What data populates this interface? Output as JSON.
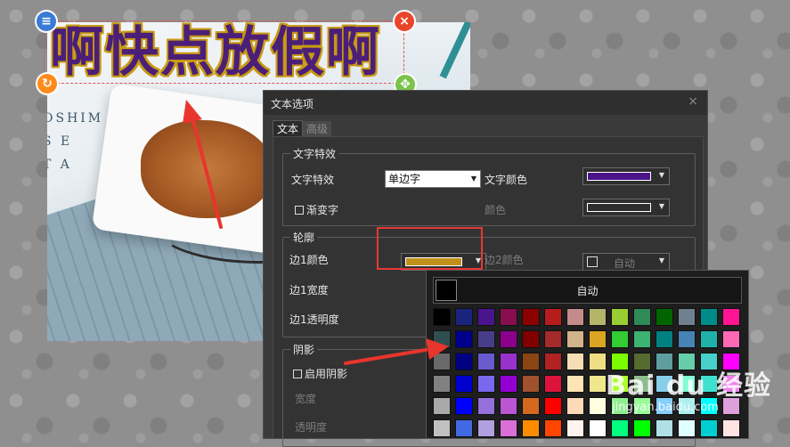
{
  "canvas": {
    "title_text": "啊快点放假啊",
    "photo_text": "OSHIM\nS E\nT A"
  },
  "dialog": {
    "title": "文本选项",
    "close_glyph": "×",
    "tabs": [
      {
        "label": "文本",
        "active": true
      },
      {
        "label": "高级",
        "active": false
      }
    ],
    "effects": {
      "legend": "文字特效",
      "effect_label": "文字特效",
      "effect_value": "单边字",
      "text_color_label": "文字颜色",
      "text_color": "#4b148a",
      "gradient_label": "渐变字",
      "color_label": "颜色",
      "color_value": "#2e2e2e"
    },
    "outline": {
      "legend": "轮廓",
      "edge1_color_label": "边1颜色",
      "edge1_color": "#c0901a",
      "edge2_color_label": "边2颜色",
      "edge2_auto": "自动",
      "edge1_width_label": "边1宽度",
      "edge1_opacity_label": "边1透明度"
    },
    "shadow": {
      "legend": "阴影",
      "enable_label": "启用阴影",
      "width_label": "宽度",
      "opacity_label": "透明度"
    }
  },
  "color_popup": {
    "auto_label": "自动",
    "colors": [
      [
        "#000000",
        "#1a237e",
        "#4a148c",
        "#880e4f",
        "#8b0000",
        "#b71c1c",
        "#c48b8b",
        "#b5b56a",
        "#9acd32",
        "#2e8b57",
        "#006400",
        "#708090",
        "#008b8b",
        "#ff1493",
        "#c71585"
      ],
      [
        "#2f4f4f",
        "#00008b",
        "#483d8b",
        "#8b008b",
        "#800000",
        "#a52a2a",
        "#d2b48c",
        "#daa520",
        "#32cd32",
        "#3cb371",
        "#008080",
        "#4682b4",
        "#20b2aa",
        "#ff69b4",
        "#db7093"
      ],
      [
        "#696969",
        "#000080",
        "#6a5acd",
        "#9932cc",
        "#8b4513",
        "#b22222",
        "#f5deb3",
        "#eedd82",
        "#7cfc00",
        "#556b2f",
        "#5f9ea0",
        "#66cdaa",
        "#48d1cc",
        "#ff00ff",
        "#ff6f91"
      ],
      [
        "#808080",
        "#0000cd",
        "#7b68ee",
        "#9400d3",
        "#a0522d",
        "#dc143c",
        "#ffe4b5",
        "#f0e68c",
        "#adff2f",
        "#8fbc8f",
        "#87ceeb",
        "#7fffd4",
        "#40e0d0",
        "#ee82ee",
        "#ffb6c1"
      ],
      [
        "#a9a9a9",
        "#0000ff",
        "#9370db",
        "#ba55d3",
        "#d2691e",
        "#ff0000",
        "#ffdab9",
        "#ffffe0",
        "#90ee90",
        "#98fb98",
        "#87cefa",
        "#afeeee",
        "#00ffff",
        "#dda0dd",
        "#ffc0cb"
      ],
      [
        "#c0c0c0",
        "#4169e1",
        "#b0a0e0",
        "#da70d6",
        "#ff8c00",
        "#ff4500",
        "#fff5ee",
        "#ffffff",
        "#00ff7f",
        "#00ff00",
        "#b0e0e6",
        "#e0ffff",
        "#00ced1",
        "#ffe4e1",
        "#ffb347"
      ]
    ]
  },
  "watermark": {
    "brand": "Bai du 经验",
    "url": "jingyan.baidu.com"
  }
}
